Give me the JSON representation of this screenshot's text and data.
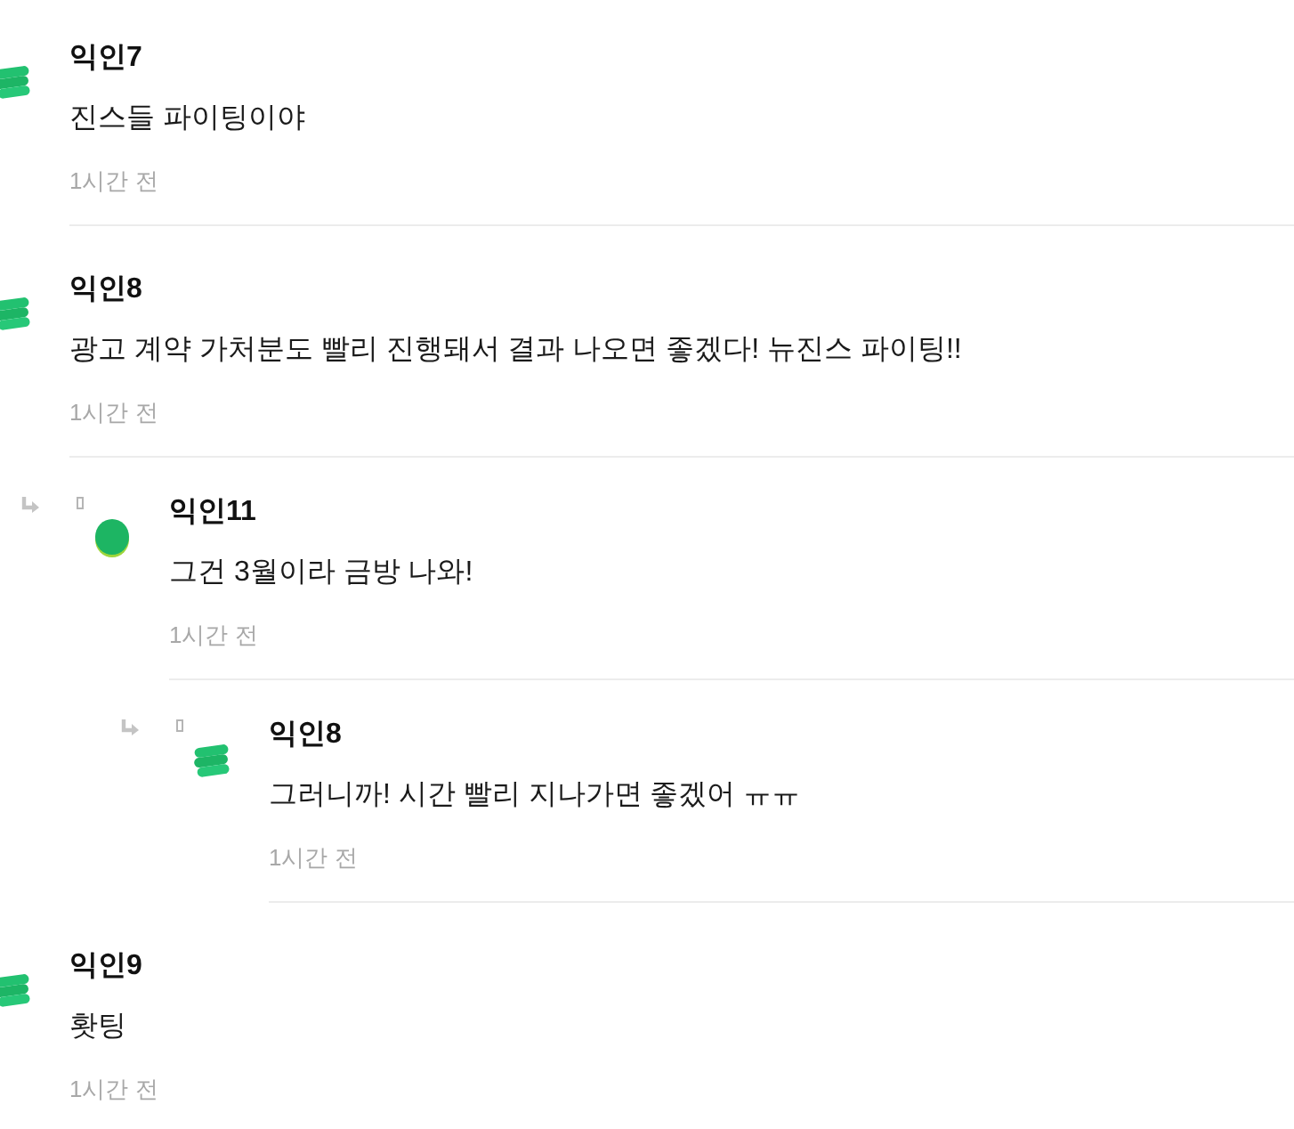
{
  "comments": [
    {
      "author": "익인7",
      "avatar": {
        "kind": "stack"
      },
      "text": "진스들 파이팅이야",
      "time": "1시간 전"
    },
    {
      "author": "익인8",
      "avatar": {
        "kind": "stack"
      },
      "text": "광고 계약 가처분도 빨리 진행돼서 결과 나오면 좋겠다! 뉴진스 파이팅!!",
      "time": "1시간 전",
      "children": [
        {
          "author": "익인11",
          "avatar": {
            "kind": "round"
          },
          "text": "그건 3월이라 금방 나와!",
          "time": "1시간 전",
          "children": [
            {
              "author": "익인8",
              "avatar": {
                "kind": "stack"
              },
              "text": "그러니까! 시간 빨리 지나가면 좋겠어 ㅠㅠ",
              "time": "1시간 전"
            }
          ]
        }
      ]
    },
    {
      "author": "익인9",
      "avatar": {
        "kind": "stack"
      },
      "text": "홧팅",
      "time": "1시간 전"
    }
  ]
}
